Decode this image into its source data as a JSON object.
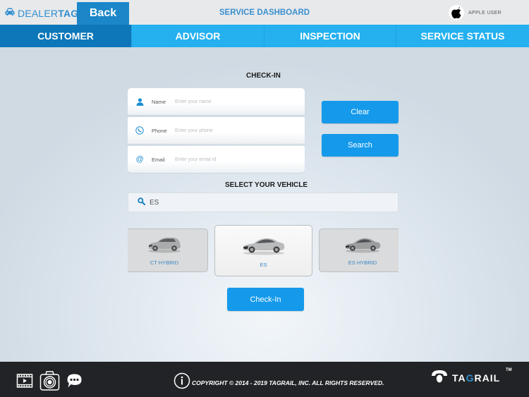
{
  "header": {
    "logo_light": "DEALER",
    "logo_bold": "TAG",
    "back_label": "Back",
    "title": "SERVICE DASHBOARD",
    "user_name": "APPLE USER"
  },
  "tabs": [
    {
      "label": "CUSTOMER",
      "active": true
    },
    {
      "label": "ADVISOR",
      "active": false
    },
    {
      "label": "INSPECTION",
      "active": false
    },
    {
      "label": "SERVICE STATUS",
      "active": false
    }
  ],
  "checkin": {
    "title": "CHECK-IN",
    "fields": [
      {
        "label": "Name",
        "icon": "person-icon",
        "value": "",
        "placeholder": "Enter your name"
      },
      {
        "label": "Phone",
        "icon": "phone-icon",
        "value": "",
        "placeholder": "Enter your phone"
      },
      {
        "label": "Email",
        "icon": "at-icon",
        "value": "",
        "placeholder": "Enter your email id"
      }
    ],
    "clear_label": "Clear",
    "search_label": "Search"
  },
  "vehicle": {
    "title": "SELECT YOUR VEHICLE",
    "search_value": "ES",
    "cars": [
      {
        "label": "CT HYBRID",
        "selected": false
      },
      {
        "label": "ES",
        "selected": true
      },
      {
        "label": "ES HYBRID",
        "selected": false
      }
    ],
    "checkin_label": "Check-In"
  },
  "footer": {
    "copyright": "COPYRIGHT © 2014 - 2019 TAGRAIL, INC. ALL RIGHTS RESERVED.",
    "brand_pre": "TA",
    "brand_g": "G",
    "brand_post": "RAIL",
    "tm": "TM"
  },
  "colors": {
    "accent": "#1b86c8",
    "tab_bar": "#25b0ef",
    "tab_active": "#0d77b9",
    "button": "#159aeb",
    "footer": "#222326"
  }
}
